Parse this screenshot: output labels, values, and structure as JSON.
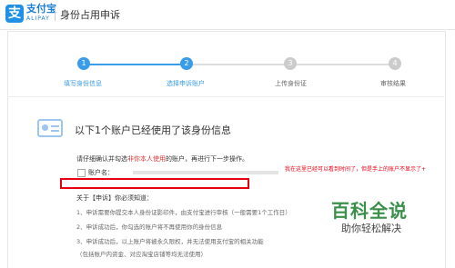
{
  "header": {
    "logo_glyph": "支",
    "brand": "支付宝",
    "brand_sub": "ALIPAY",
    "title": "身份占用申诉"
  },
  "steps": [
    {
      "number": "1",
      "label": "填写身份信息",
      "state": "done"
    },
    {
      "number": "2",
      "label": "选择申诉账户",
      "state": "current"
    },
    {
      "number": "3",
      "label": "上传身份证",
      "state": "pending"
    },
    {
      "number": "4",
      "label": "审核结果",
      "state": "pending"
    }
  ],
  "section": {
    "icon": "id-card-icon",
    "title": "以下1个账户已经使用了该身份信息",
    "instruction_prefix": "请仔细确认并勾选",
    "instruction_highlight": "非你本人使用",
    "instruction_suffix": "的账户，再进行下一步操作。",
    "account_label": "账户名："
  },
  "annotation": "我在这里已经可以看到时间了，但是手上的账户不显示了+",
  "about": {
    "heading": "关于【申诉】你必须知道：",
    "notes": [
      "1、申诉需要你提交本人身份证影印件，由支付宝进行审核（一般需要1个工作日）",
      "2、申诉成功后，你勾选的账户将不再使用你的身份信息",
      "3、申诉成功后，以上账户将被永久限权，并无法使用支付宝的相关功能",
      "（包括账户内资金、对应淘宝店铺等均无法使用）"
    ]
  },
  "watermark": {
    "main": "百科全说",
    "sub": "助你轻松解决"
  },
  "colors": {
    "accent": "#3a9de8",
    "warning": "#e60012",
    "brand": "#1e7fd6"
  }
}
